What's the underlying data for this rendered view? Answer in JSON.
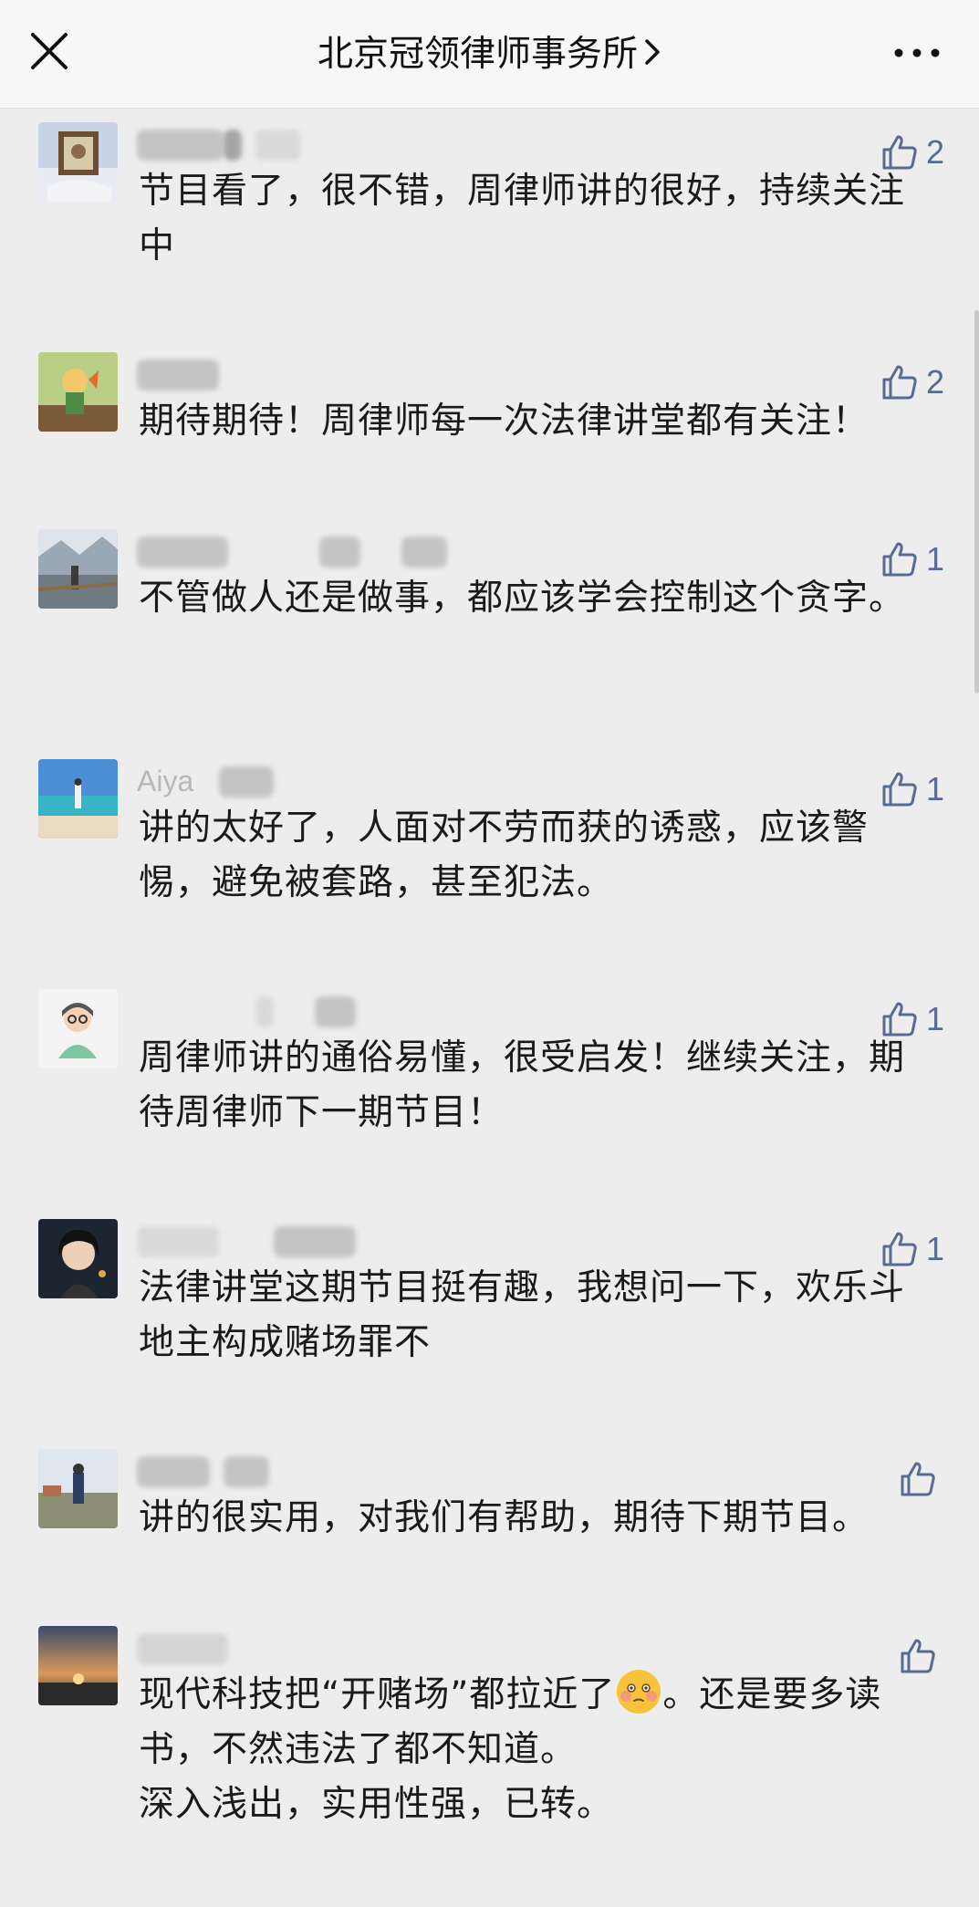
{
  "header": {
    "title": "北京冠领律师事务所"
  },
  "colors": {
    "header_bg": "#f7f7f7",
    "page_bg": "#ededed",
    "like_blue": "#576b95",
    "text": "#1a1a1a"
  },
  "icons": {
    "close": "close-icon",
    "chevron": "chevron-right-icon",
    "more": "more-dots-icon",
    "like": "thumbs-up-icon",
    "emoji": "flushed-face-emoji"
  },
  "comments": [
    {
      "nickname_visible": "",
      "likes": "2",
      "text": "节目看了，很不错，周律师讲的很好，持续关注中"
    },
    {
      "nickname_visible": "",
      "likes": "2",
      "text": "期待期待！周律师每一次法律讲堂都有关注！"
    },
    {
      "nickname_visible": "",
      "likes": "1",
      "text": "不管做人还是做事，都应该学会控制这个贪字。"
    },
    {
      "nickname_visible": "Aiya",
      "likes": "1",
      "text": "讲的太好了，人面对不劳而获的诱惑，应该警惕，避免被套路，甚至犯法。"
    },
    {
      "nickname_visible": "",
      "likes": "1",
      "text": "周律师讲的通俗易懂，很受启发！继续关注，期待周律师下一期节目！"
    },
    {
      "nickname_visible": "",
      "likes": "1",
      "text": "法律讲堂这期节目挺有趣，我想问一下，欢乐斗地主构成赌场罪不"
    },
    {
      "nickname_visible": "",
      "likes": "",
      "text": "讲的很实用，对我们有帮助，期待下期节目。"
    },
    {
      "nickname_visible": "",
      "likes": "",
      "text_part1": "现代科技把“开赌场”都拉近了",
      "text_part2": "。还是要多读书，不然违法了都不知道。\n深入浅出，实用性强，已转。"
    }
  ]
}
